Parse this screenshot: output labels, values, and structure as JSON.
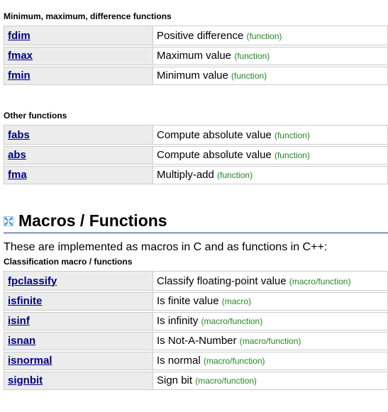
{
  "minmax": {
    "title": "Minimum, maximum, difference functions",
    "rows": [
      {
        "name": "fdim",
        "desc": "Positive difference",
        "kind": "(function)"
      },
      {
        "name": "fmax",
        "desc": "Maximum value",
        "kind": "(function)"
      },
      {
        "name": "fmin",
        "desc": "Minimum value",
        "kind": "(function)"
      }
    ]
  },
  "other": {
    "title": "Other functions",
    "rows": [
      {
        "name": "fabs",
        "desc": "Compute absolute value",
        "kind": "(function)"
      },
      {
        "name": "abs",
        "desc": "Compute absolute value",
        "kind": "(function)"
      },
      {
        "name": "fma",
        "desc": "Multiply-add",
        "kind": "(function)"
      }
    ]
  },
  "macros": {
    "heading": "Macros / Functions",
    "icon": "expand-section-icon",
    "intro": "These are implemented as macros in C and as functions in C++:"
  },
  "classification": {
    "title": "Classification macro / functions",
    "rows": [
      {
        "name": "fpclassify",
        "desc": "Classify floating-point value",
        "kind": "(macro/function)"
      },
      {
        "name": "isfinite",
        "desc": "Is finite value",
        "kind": "(macro)"
      },
      {
        "name": "isinf",
        "desc": "Is infinity",
        "kind": "(macro/function)"
      },
      {
        "name": "isnan",
        "desc": "Is Not-A-Number",
        "kind": "(macro/function)"
      },
      {
        "name": "isnormal",
        "desc": "Is normal",
        "kind": "(macro/function)"
      },
      {
        "name": "signbit",
        "desc": "Sign bit",
        "kind": "(macro/function)"
      }
    ]
  },
  "colors": {
    "link": "#000080",
    "kind": "#228822",
    "name_cell_bg": "#ececec",
    "border": "#cccccc",
    "icon": "#3a8ed8"
  }
}
